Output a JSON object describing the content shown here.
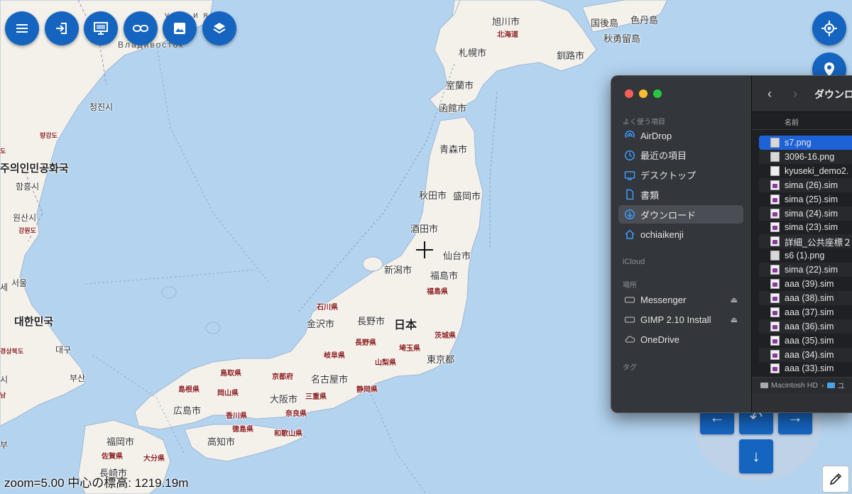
{
  "map": {
    "zoom_info": "zoom=5.00 中心の標高: 1219.19m",
    "labels": {
      "asahikawa": "旭川市",
      "kokugo": "国後島",
      "shikotan": "色丹島",
      "etorofu": "秋勇留島",
      "hokkaido": "北海道",
      "sapporo": "札幌市",
      "kushiro": "釧路市",
      "muroran": "室蘭市",
      "hakodate": "函館市",
      "aomori": "青森市",
      "akita": "秋田市",
      "morioka": "盛岡市",
      "sakata": "酒田市",
      "sendai": "仙台市",
      "niigata": "新潟市",
      "fukushima": "福島市",
      "fukushima_pref": "福島県",
      "ishikawa": "石川県",
      "kanazawa": "金沢市",
      "nagano": "長野市",
      "japan": "日本",
      "ibaraki": "茨城県",
      "gifu": "岐阜県",
      "nagano_pref": "長野県",
      "saitama": "埼玉県",
      "yamanashi": "山梨県",
      "tokyo": "東京都",
      "tottori": "鳥取県",
      "kyoto": "京都府",
      "nagoya": "名古屋市",
      "shimane": "島根県",
      "okayama": "岡山県",
      "osaka": "大阪市",
      "mie": "三重県",
      "shizuoka": "静岡県",
      "hiroshima": "広島市",
      "kagawa": "香川県",
      "nara": "奈良県",
      "tokushima": "徳島県",
      "wakayama": "和歌山県",
      "fukuoka": "福岡市",
      "kochi": "高知市",
      "saga": "佐賀県",
      "oita": "大分県",
      "nagasaki": "長崎市",
      "vladivostok": "Владивосток",
      "russia_partial": "у с с и я",
      "cheongjin": "청진시",
      "ryanggang": "량강도",
      "dprk": "주의인민공화국",
      "hamhung": "함흥시",
      "wonsan": "원산시",
      "gangwon": "강원도",
      "seoul": "서울",
      "korea": "대한민국",
      "gyeongbuk": "경상북도",
      "daegu": "대구",
      "busan": "부산",
      "se": "세",
      "do": "도",
      "si": "시",
      "nam": "남",
      "bu": "부"
    }
  },
  "toolbar": {
    "buttons": [
      "menu",
      "login",
      "display",
      "link",
      "image",
      "layers"
    ]
  },
  "finder": {
    "sidebar": {
      "favorites_header": "よく使う項目",
      "favorites": [
        {
          "label": "AirDrop",
          "icon": "airdrop-icon"
        },
        {
          "label": "最近の項目",
          "icon": "clock-icon"
        },
        {
          "label": "デスクトップ",
          "icon": "desktop-icon"
        },
        {
          "label": "書類",
          "icon": "document-icon"
        },
        {
          "label": "ダウンロード",
          "icon": "download-icon",
          "selected": true
        },
        {
          "label": "ochiaikenji",
          "icon": "home-icon"
        }
      ],
      "icloud_header": "iCloud",
      "locations_header": "場所",
      "locations": [
        {
          "label": "Messenger",
          "icon": "disk-icon",
          "eject": true
        },
        {
          "label": "GIMP 2.10 Install",
          "icon": "disk-icon",
          "eject": true
        },
        {
          "label": "OneDrive",
          "icon": "cloud-icon",
          "eject": false
        }
      ],
      "tags_header": "タグ"
    },
    "folder_title": "ダウンロ",
    "column_name": "名前",
    "files": [
      {
        "name": "s7.png",
        "type": "png",
        "selected": true
      },
      {
        "name": "3096-16.png",
        "type": "png"
      },
      {
        "name": "kyuseki_demo2.",
        "type": "doc"
      },
      {
        "name": "sima (26).sim",
        "type": "sim"
      },
      {
        "name": "sima (25).sim",
        "type": "sim"
      },
      {
        "name": "sima (24).sim",
        "type": "sim"
      },
      {
        "name": "sima (23).sim",
        "type": "sim"
      },
      {
        "name": "詳細_公共座標２系",
        "type": "sim"
      },
      {
        "name": "s6 (1).png",
        "type": "png"
      },
      {
        "name": "sima (22).sim",
        "type": "sim"
      },
      {
        "name": "aaa (39).sim",
        "type": "sim"
      },
      {
        "name": "aaa (38).sim",
        "type": "sim"
      },
      {
        "name": "aaa (37).sim",
        "type": "sim"
      },
      {
        "name": "aaa (36).sim",
        "type": "sim"
      },
      {
        "name": "aaa (35).sim",
        "type": "sim"
      },
      {
        "name": "aaa (34).sim",
        "type": "sim"
      },
      {
        "name": "aaa (33).sim",
        "type": "sim"
      }
    ],
    "path": {
      "disk": "Macintosh HD",
      "sep": "›",
      "next": "ユ"
    }
  },
  "colors": {
    "accent": "#1565c0",
    "sea": "#b3d3ef",
    "land": "#f4f1ea",
    "finder_selected": "#1d62d6"
  }
}
